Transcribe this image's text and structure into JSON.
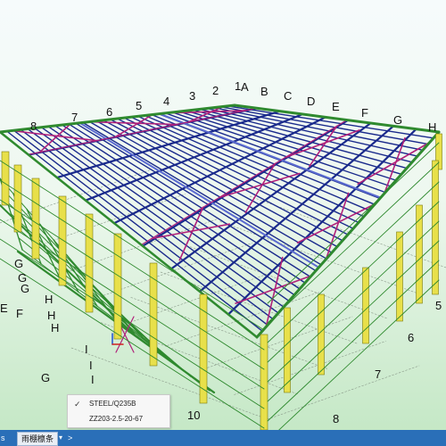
{
  "scene": {
    "description_labels": {
      "top_numbers": [
        "8",
        "7",
        "6",
        "5",
        "4",
        "3",
        "2",
        "1"
      ],
      "top_letters": [
        "A",
        "B",
        "C",
        "D",
        "E",
        "F",
        "G",
        "H"
      ],
      "right_numbers": [
        "5",
        "6",
        "7",
        "8"
      ],
      "left_letters": [
        "G",
        "G",
        "G",
        "H",
        "H",
        "H",
        "F",
        "G",
        "I",
        "I",
        "I"
      ],
      "bottom_number": "10"
    },
    "colors": {
      "background_top": "#f6fbfc",
      "background_bottom": "#cbeacb",
      "purlin": "#1a2a8c",
      "rafter": "#1a2a8c",
      "bracing": "#b0207a",
      "edge_beam": "#2f8a2f",
      "column": "#e8e04a",
      "column_edge": "#7a7a10"
    }
  },
  "dropdown": {
    "items": [
      {
        "label": "STEEL/Q235B",
        "checked": true
      },
      {
        "label": "ZZ203-2.5-20-67",
        "checked": false
      }
    ]
  },
  "statusbar": {
    "left_text": "s",
    "tab_label": "雨棚檩条",
    "dropdown_glyph": "▾",
    "next_glyph": ">"
  }
}
